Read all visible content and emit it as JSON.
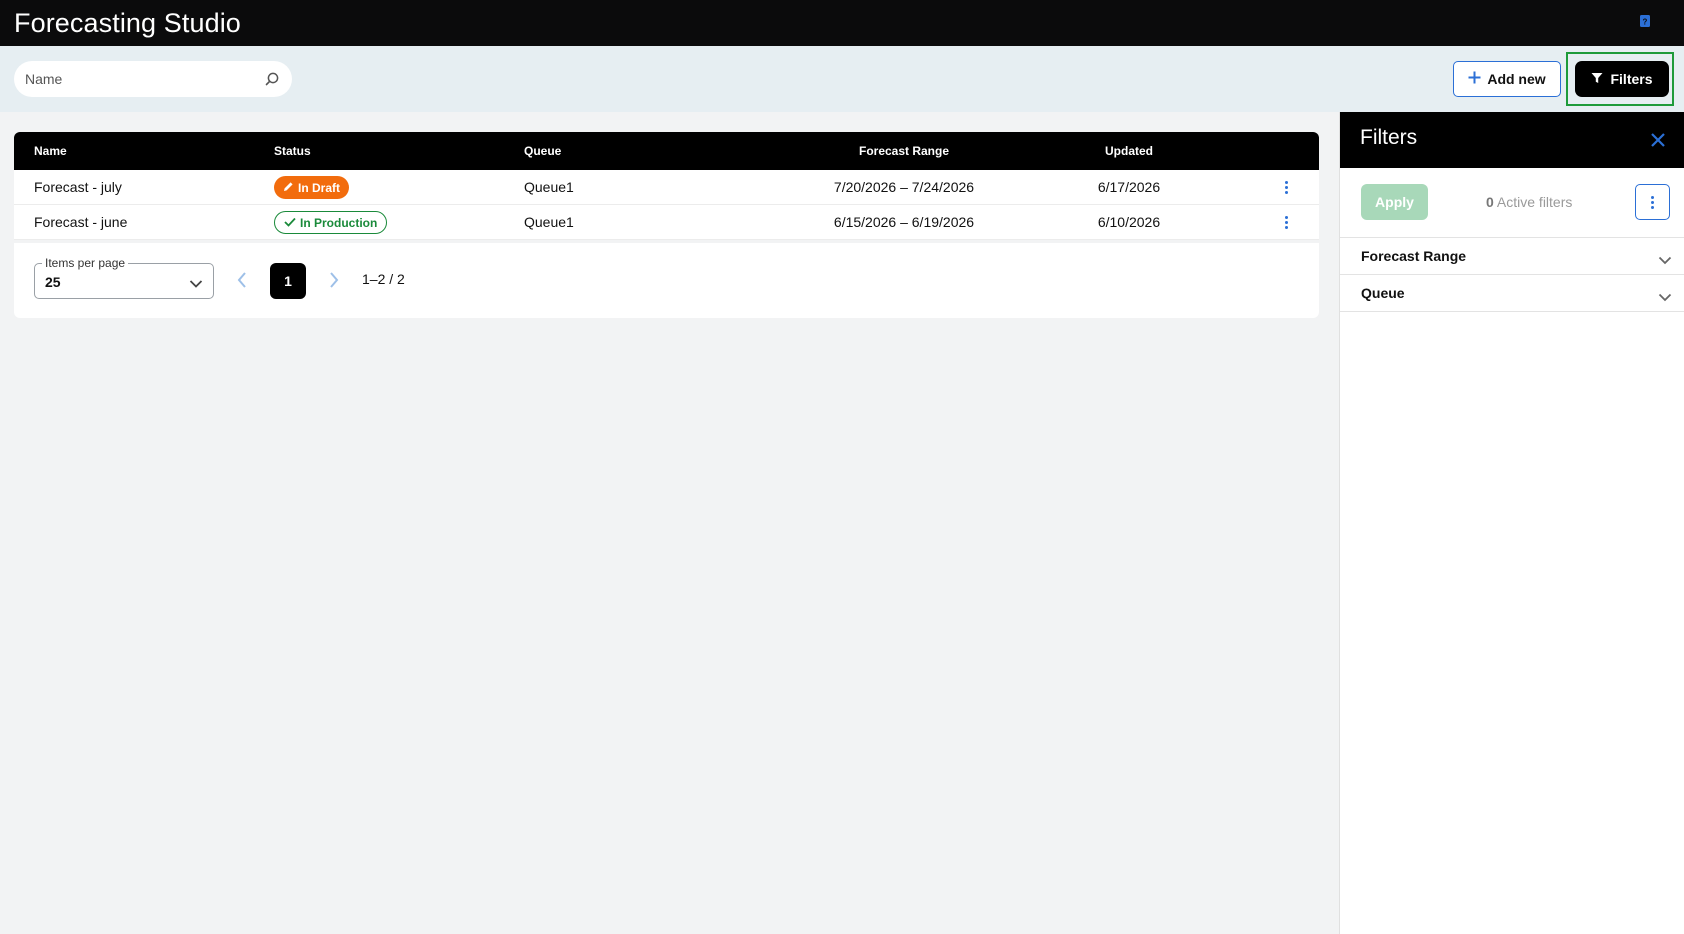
{
  "app": {
    "title": "Forecasting Studio"
  },
  "toolbar": {
    "search_placeholder": "Name",
    "add_new_label": "Add new",
    "filters_label": "Filters"
  },
  "table": {
    "columns": {
      "name": "Name",
      "status": "Status",
      "queue": "Queue",
      "forecast_range": "Forecast Range",
      "updated": "Updated"
    },
    "rows": [
      {
        "name": "Forecast - july",
        "status": "In Draft",
        "queue": "Queue1",
        "forecast_range": "7/20/2026 – 7/24/2026",
        "updated": "6/17/2026"
      },
      {
        "name": "Forecast - june",
        "status": "In Production",
        "queue": "Queue1",
        "forecast_range": "6/15/2026 – 6/19/2026",
        "updated": "6/10/2026"
      }
    ]
  },
  "pagination": {
    "items_per_page_label": "Items per page",
    "items_per_page_value": "25",
    "current_page": "1",
    "range_text": "1–2 / 2"
  },
  "filters_panel": {
    "title": "Filters",
    "apply_label": "Apply",
    "active_count": "0",
    "active_label": "Active filters",
    "sections": [
      "Forecast Range",
      "Queue"
    ]
  },
  "colors": {
    "accent_blue": "#2b6fd6",
    "draft_orange": "#f26c0d",
    "production_green": "#1a8a3a",
    "apply_disabled": "#a8d8b9",
    "highlight_frame": "#1e9b3a"
  },
  "icons": {
    "help": "help-book-icon",
    "search": "search-icon",
    "add": "plus-icon",
    "filter": "filter-funnel-icon",
    "draft": "pencil-icon",
    "production": "check-icon",
    "row_menu": "kebab-menu-icon",
    "close": "close-icon",
    "chevron": "chevron-down-icon"
  }
}
